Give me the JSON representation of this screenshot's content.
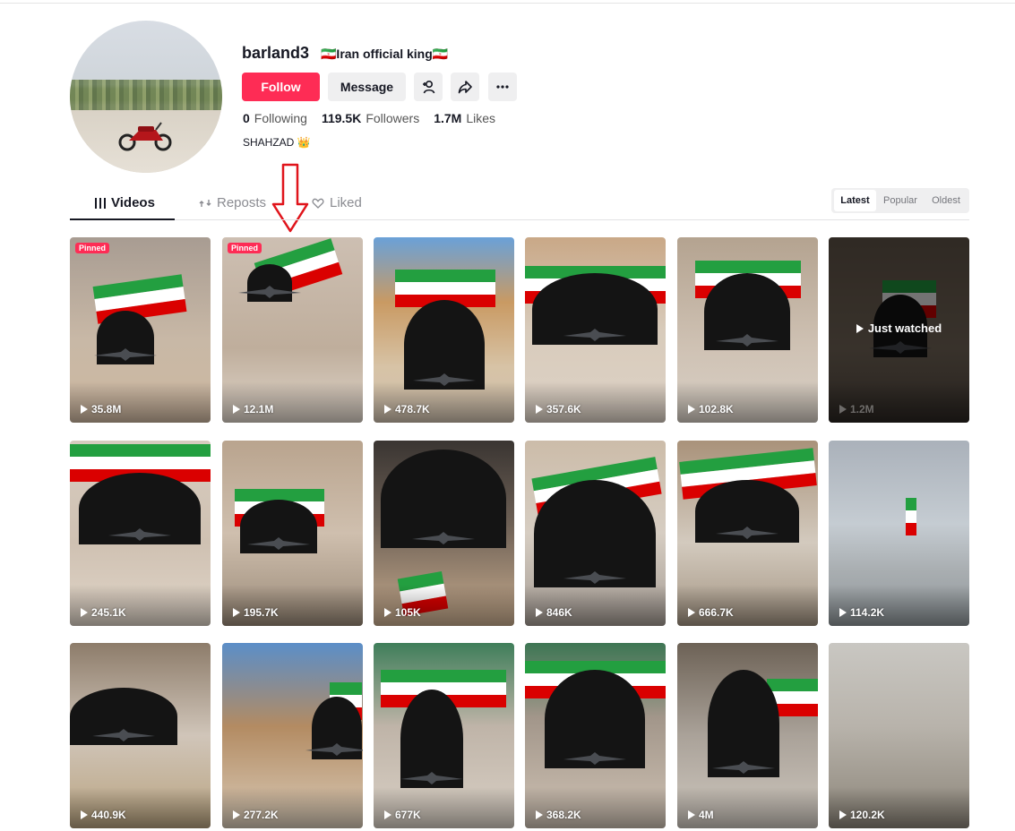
{
  "profile": {
    "username": "barland3",
    "nickname": "🇮🇷Iran official king🇮🇷",
    "bio": "SHAHZAD 👑",
    "buttons": {
      "follow": "Follow",
      "message": "Message"
    },
    "stats": [
      {
        "value": "0",
        "label": "Following"
      },
      {
        "value": "119.5K",
        "label": "Followers"
      },
      {
        "value": "1.7M",
        "label": "Likes"
      }
    ]
  },
  "tabs": [
    {
      "label": "Videos",
      "icon": "grid-icon",
      "active": true
    },
    {
      "label": "Reposts",
      "icon": "repost-icon",
      "active": false
    },
    {
      "label": "Liked",
      "icon": "heart-lock-icon",
      "active": false
    }
  ],
  "sort": {
    "options": [
      "Latest",
      "Popular",
      "Oldest"
    ],
    "selected": "Latest"
  },
  "videos": [
    {
      "views": "35.8M",
      "pinned": "Pinned"
    },
    {
      "views": "12.1M",
      "pinned": "Pinned"
    },
    {
      "views": "478.7K"
    },
    {
      "views": "357.6K"
    },
    {
      "views": "102.8K"
    },
    {
      "views": "1.2M",
      "overlay": "Just watched"
    },
    {
      "views": "245.1K"
    },
    {
      "views": "195.7K"
    },
    {
      "views": "105K"
    },
    {
      "views": "846K"
    },
    {
      "views": "666.7K"
    },
    {
      "views": "114.2K"
    },
    {
      "views": "440.9K"
    },
    {
      "views": "277.2K"
    },
    {
      "views": "677K"
    },
    {
      "views": "368.2K"
    },
    {
      "views": "4M"
    },
    {
      "views": "120.2K"
    }
  ],
  "colors": {
    "accent": "#fe2c55",
    "text": "#161823",
    "flag_green": "#239f40",
    "flag_red": "#da0000"
  }
}
